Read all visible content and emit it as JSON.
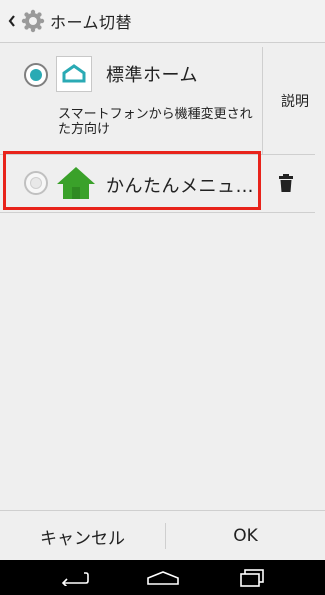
{
  "header": {
    "title": "ホーム切替"
  },
  "options": [
    {
      "label": "標準ホーム",
      "description": "スマートフォンから機種変更された方向け",
      "selected": true
    },
    {
      "label": "かんたんメニュ…",
      "selected": false
    }
  ],
  "side": {
    "explain_label": "説明"
  },
  "footer": {
    "cancel_label": "キャンセル",
    "ok_label": "OK"
  },
  "icons": {
    "back": "chevron-left-icon",
    "settings": "gear-icon",
    "home_standard": "home-outline-icon",
    "home_easy": "green-house-icon",
    "delete": "trash-icon",
    "nav_back": "back-arrow-icon",
    "nav_home": "home-icon",
    "nav_recent": "recent-apps-icon"
  },
  "colors": {
    "accent": "#2aaab4",
    "highlight": "#e8231b",
    "easy_home": "#3aa12a"
  }
}
